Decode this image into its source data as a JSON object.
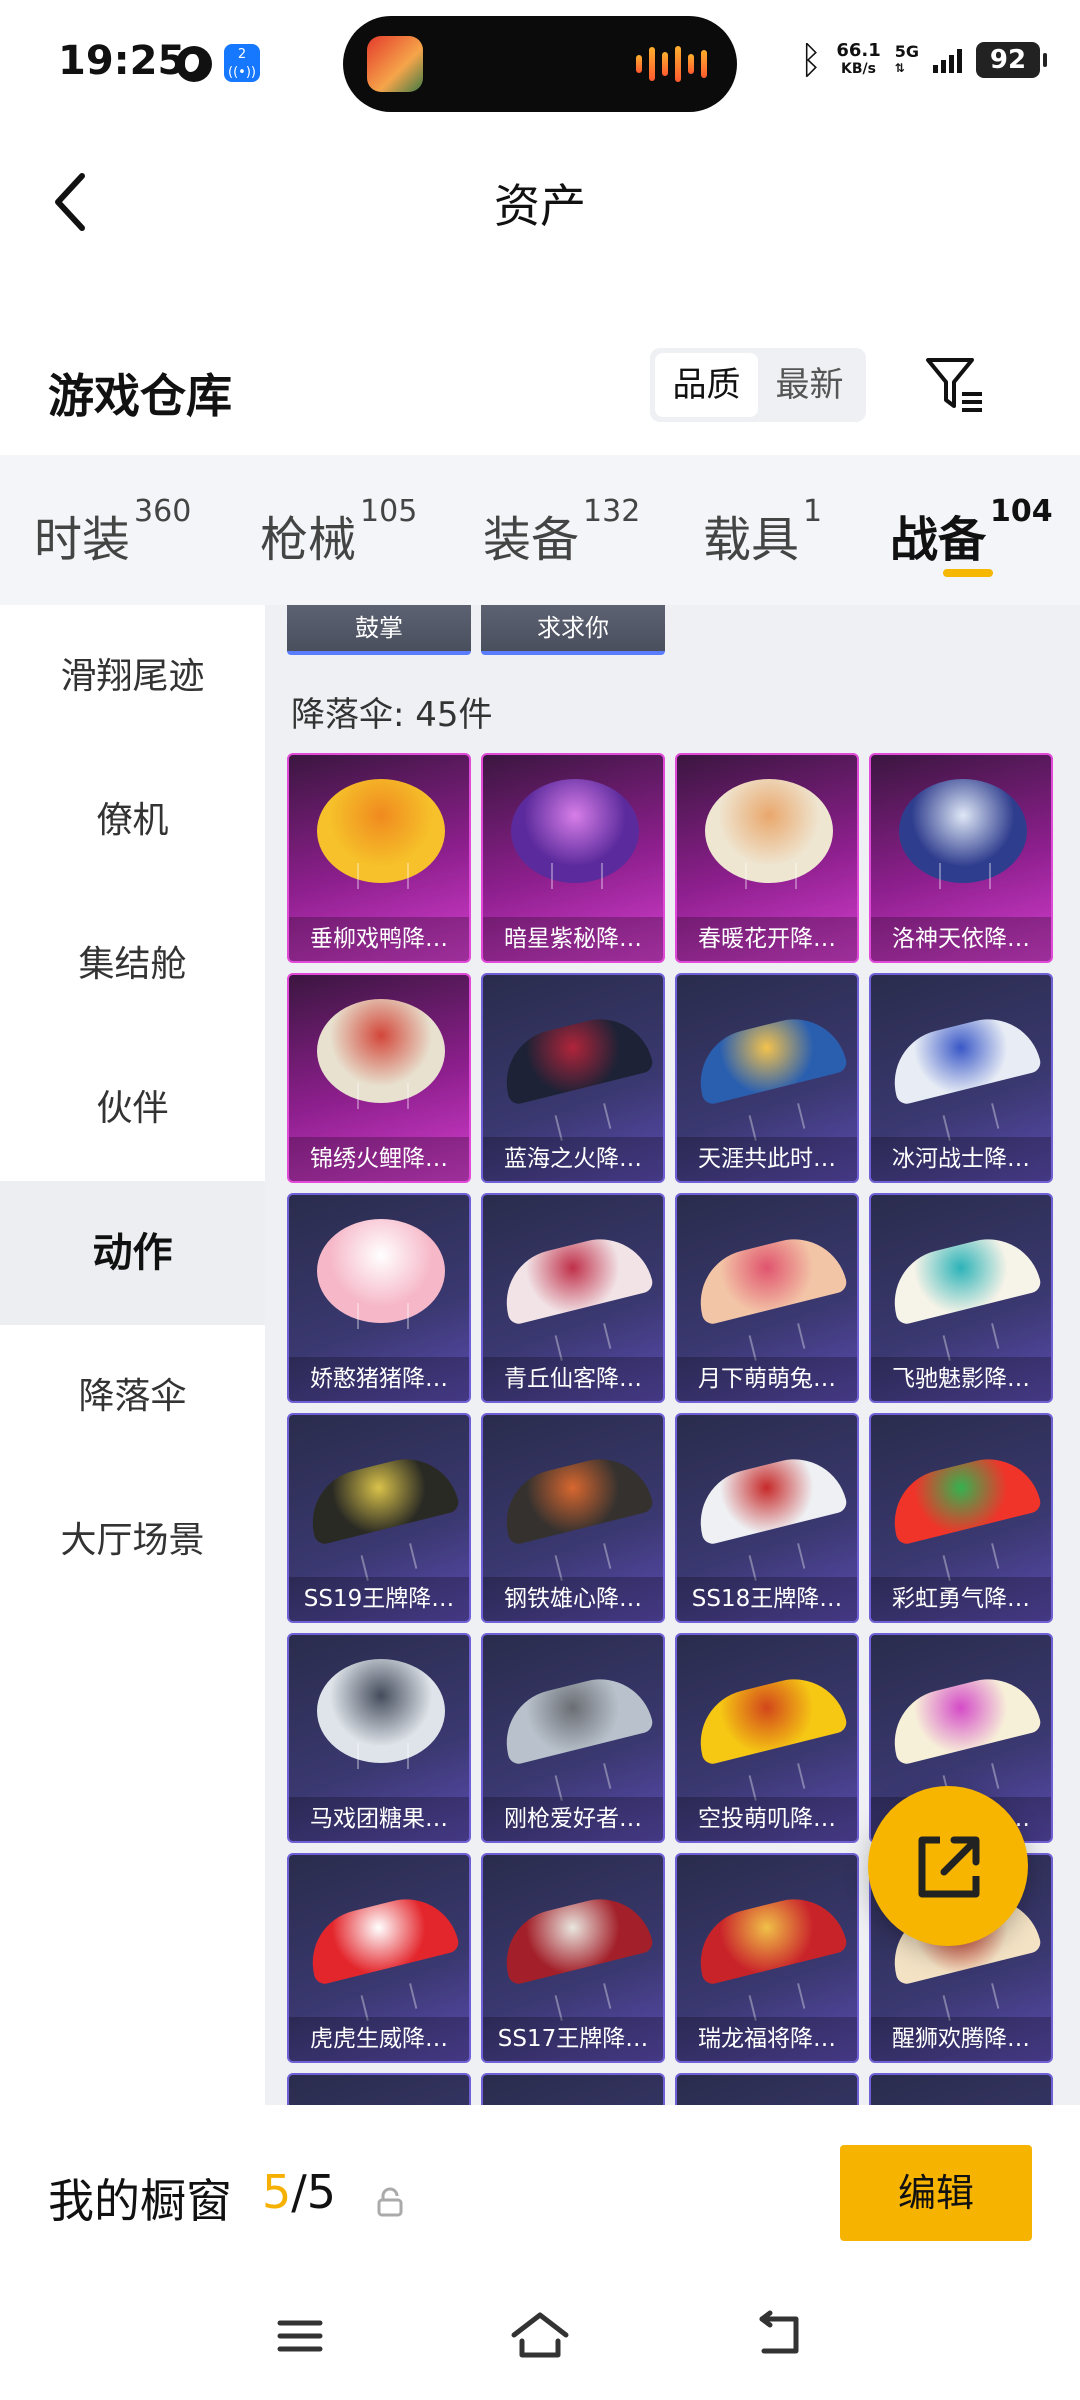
{
  "status_bar": {
    "time": "19:25",
    "nfc_badge": "2",
    "net_speed_value": "66.1",
    "net_speed_unit": "KB/s",
    "network": "5G",
    "battery": "92"
  },
  "header": {
    "title": "资产"
  },
  "warehouse": {
    "title": "游戏仓库",
    "sort_options": [
      "品质",
      "最新"
    ],
    "active_sort": "品质"
  },
  "tabs": [
    {
      "label": "时装",
      "count": "360"
    },
    {
      "label": "枪械",
      "count": "105"
    },
    {
      "label": "装备",
      "count": "132"
    },
    {
      "label": "载具",
      "count": "1"
    },
    {
      "label": "战备",
      "count": "104"
    }
  ],
  "left_nav": [
    "滑翔尾迹",
    "僚机",
    "集结舱",
    "伙伴",
    "动作",
    "降落伞",
    "大厅场景"
  ],
  "active_nav": "动作",
  "emotes": [
    "鼓掌",
    "求求你"
  ],
  "section": {
    "title": "降落伞: 45件"
  },
  "items": [
    {
      "label": "垂柳戏鸭降…",
      "rarity": "epic",
      "color": "#f6c12a",
      "accent": "#f08a1f",
      "shape": "round"
    },
    {
      "label": "暗星紫秘降…",
      "rarity": "epic",
      "color": "#5b2a9c",
      "accent": "#d77ee8",
      "shape": "round"
    },
    {
      "label": "春暖花开降…",
      "rarity": "epic",
      "color": "#efe6d2",
      "accent": "#e9a76c",
      "shape": "round"
    },
    {
      "label": "洛神天依降…",
      "rarity": "epic",
      "color": "#2f3d8e",
      "accent": "#dfe8f6",
      "shape": "round"
    },
    {
      "label": "锦绣火鲤降…",
      "rarity": "epic",
      "color": "#e8e1cf",
      "accent": "#d2473a",
      "shape": "round"
    },
    {
      "label": "蓝海之火降…",
      "rarity": "legendary",
      "color": "#1e2236",
      "accent": "#b0243a",
      "shape": "wing"
    },
    {
      "label": "天涯共此时…",
      "rarity": "legendary",
      "color": "#2a5fb0",
      "accent": "#f3c24d",
      "shape": "wing"
    },
    {
      "label": "冰河战士降…",
      "rarity": "legendary",
      "color": "#e7ecf5",
      "accent": "#3a58c7",
      "shape": "wing"
    },
    {
      "label": "娇憨猪猪降…",
      "rarity": "legendary",
      "color": "#f6b8c9",
      "accent": "#ffffff",
      "shape": "round"
    },
    {
      "label": "青丘仙客降…",
      "rarity": "legendary",
      "color": "#f1e3e6",
      "accent": "#c0304a",
      "shape": "wing"
    },
    {
      "label": "月下萌萌兔…",
      "rarity": "legendary",
      "color": "#f3c5a7",
      "accent": "#e0546e",
      "shape": "wing"
    },
    {
      "label": "飞驰魅影降…",
      "rarity": "legendary",
      "color": "#f6f3e8",
      "accent": "#2cb3b8",
      "shape": "wing"
    },
    {
      "label": "SS19王牌降…",
      "rarity": "legendary",
      "color": "#2a2a24",
      "accent": "#d9c24a",
      "shape": "wing"
    },
    {
      "label": "钢铁雄心降…",
      "rarity": "legendary",
      "color": "#34312f",
      "accent": "#d8672f",
      "shape": "wing"
    },
    {
      "label": "SS18王牌降…",
      "rarity": "legendary",
      "color": "#eef0f3",
      "accent": "#c72a2a",
      "shape": "wing"
    },
    {
      "label": "彩虹勇气降…",
      "rarity": "legendary",
      "color": "#f0342a",
      "accent": "#35b24f",
      "shape": "wing"
    },
    {
      "label": "马戏团糖果…",
      "rarity": "legendary",
      "color": "#dfe4ea",
      "accent": "#444c5c",
      "shape": "round"
    },
    {
      "label": "刚枪爱好者…",
      "rarity": "legendary",
      "color": "#b9c2cc",
      "accent": "#6a6d74",
      "shape": "wing"
    },
    {
      "label": "空投萌叽降…",
      "rarity": "legendary",
      "color": "#f6c814",
      "accent": "#d2461b",
      "shape": "wing"
    },
    {
      "label": "异彩先驱降…",
      "rarity": "legendary",
      "color": "#f7f0d8",
      "accent": "#d44bc8",
      "shape": "wing"
    },
    {
      "label": "虎虎生威降…",
      "rarity": "legendary",
      "color": "#e3262c",
      "accent": "#ffffff",
      "shape": "wing"
    },
    {
      "label": "SS17王牌降…",
      "rarity": "legendary",
      "color": "#a3202a",
      "accent": "#e9e6df",
      "shape": "wing"
    },
    {
      "label": "瑞龙福将降…",
      "rarity": "legendary",
      "color": "#c9232a",
      "accent": "#f0c048",
      "shape": "wing"
    },
    {
      "label": "醒狮欢腾降…",
      "rarity": "legendary",
      "color": "#f3e2c4",
      "accent": "#cf3b2b",
      "shape": "wing"
    },
    {
      "label": "",
      "rarity": "legendary",
      "color": "#2a2c4c",
      "accent": "#2a2c4c",
      "shape": "none"
    },
    {
      "label": "",
      "rarity": "legendary",
      "color": "#2a2c4c",
      "accent": "#2a2c4c",
      "shape": "none"
    },
    {
      "label": "",
      "rarity": "legendary",
      "color": "#2a2c4c",
      "accent": "#2a2c4c",
      "shape": "none"
    },
    {
      "label": "",
      "rarity": "legendary",
      "color": "#2a2c4c",
      "accent": "#2a2c4c",
      "shape": "none"
    }
  ],
  "showcase": {
    "label": "我的橱窗",
    "current": "5",
    "separator": "/",
    "total": "5",
    "edit_label": "编辑"
  },
  "colors": {
    "accent": "#f6b400",
    "epic_border": "#e14ad8",
    "legendary_border": "#6f60d6"
  },
  "icons": {
    "back": "chevron-left-icon",
    "filter": "filter-icon",
    "share": "share-icon",
    "lock": "lock-icon",
    "menu": "menu-icon",
    "home": "home-icon",
    "return": "return-icon"
  }
}
